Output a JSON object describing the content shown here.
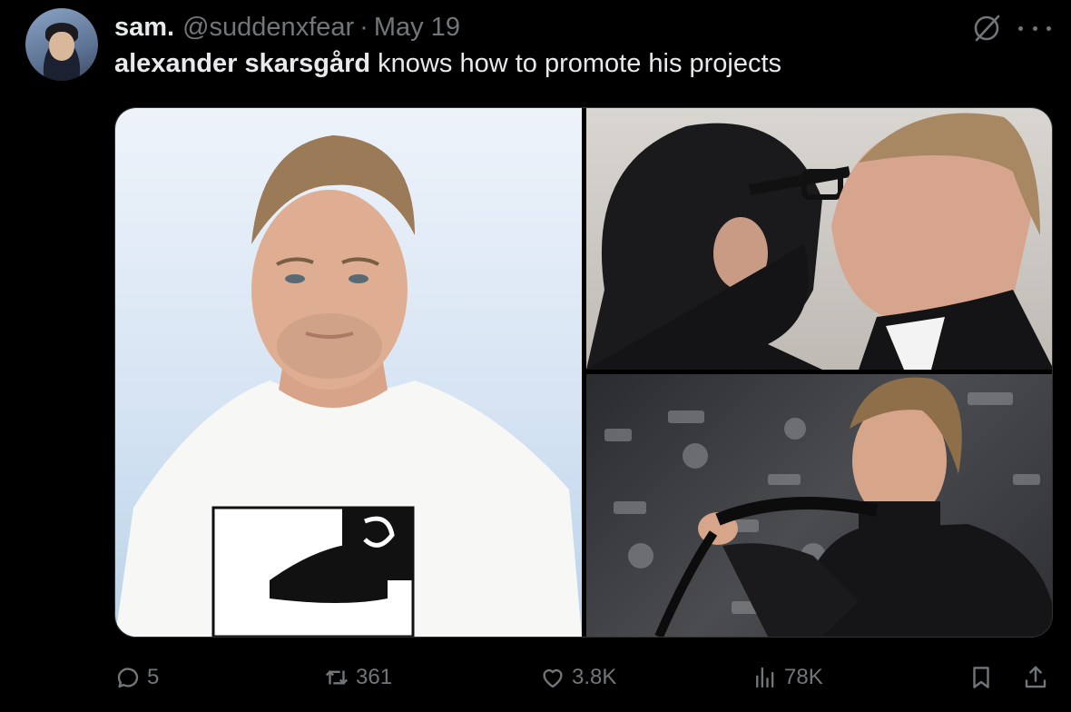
{
  "author": {
    "display_name": "sam.",
    "handle": "@suddenxfear",
    "separator": "·",
    "date": "May 19"
  },
  "tweet": {
    "bold_text": "alexander skarsgård",
    "text": " knows how to promote his projects"
  },
  "media": {
    "photos": [
      {
        "description_icon": "portrait-photo"
      },
      {
        "description_icon": "kiss-photo"
      },
      {
        "description_icon": "leash-photo"
      }
    ]
  },
  "actions": {
    "replies": "5",
    "retweets": "361",
    "likes": "3.8K",
    "views": "78K"
  },
  "colors": {
    "text": "#e7e9ea",
    "muted": "#71767b",
    "background": "#000000",
    "border": "#2f3336"
  }
}
